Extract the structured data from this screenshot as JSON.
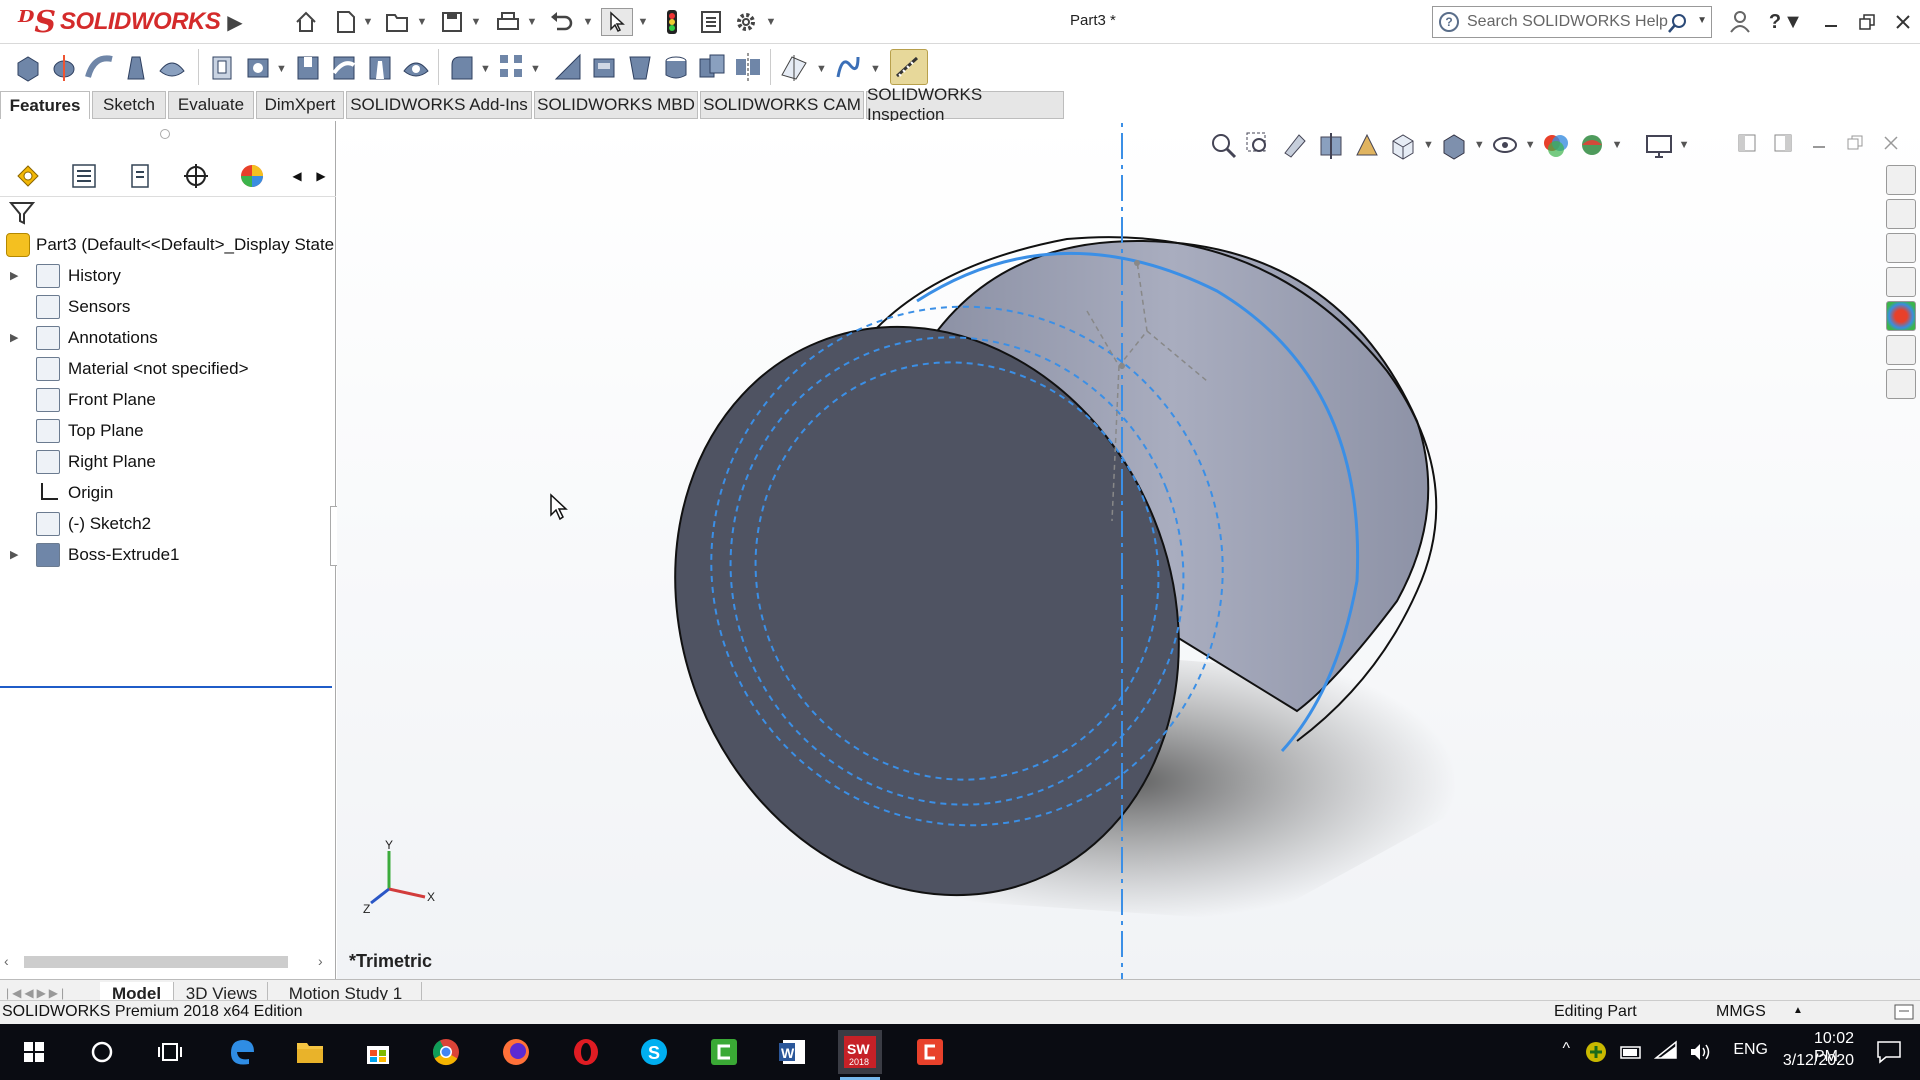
{
  "titlebar": {
    "brand": "SOLIDWORKS",
    "doc_title": "Part3 *",
    "search_placeholder": "Search SOLIDWORKS Help"
  },
  "tabs": [
    {
      "label": "Features",
      "active": true
    },
    {
      "label": "Sketch"
    },
    {
      "label": "Evaluate"
    },
    {
      "label": "DimXpert"
    },
    {
      "label": "SOLIDWORKS Add-Ins"
    },
    {
      "label": "SOLIDWORKS MBD"
    },
    {
      "label": "SOLIDWORKS CAM"
    },
    {
      "label": "SOLIDWORKS Inspection"
    }
  ],
  "tree": {
    "root": "Part3  (Default<<Default>_Display State",
    "items": [
      {
        "label": "History",
        "expandable": true,
        "icon": "history-icon"
      },
      {
        "label": "Sensors",
        "expandable": false,
        "icon": "sensors-icon"
      },
      {
        "label": "Annotations",
        "expandable": true,
        "icon": "annotations-icon"
      },
      {
        "label": "Material <not specified>",
        "expandable": false,
        "icon": "material-icon"
      },
      {
        "label": "Front Plane",
        "expandable": false,
        "icon": "plane-icon"
      },
      {
        "label": "Top Plane",
        "expandable": false,
        "icon": "plane-icon"
      },
      {
        "label": "Right Plane",
        "expandable": false,
        "icon": "plane-icon"
      },
      {
        "label": "Origin",
        "expandable": false,
        "icon": "origin-icon"
      },
      {
        "label": "(-) Sketch2",
        "expandable": false,
        "icon": "sketch-icon"
      },
      {
        "label": "Boss-Extrude1",
        "expandable": true,
        "icon": "extrude-icon"
      }
    ]
  },
  "viewport": {
    "view_name": "*Trimetric",
    "triad": {
      "x": "X",
      "y": "Y",
      "z": "Z"
    }
  },
  "bottom_tabs": [
    {
      "label": "Model",
      "active": true
    },
    {
      "label": "3D Views"
    },
    {
      "label": "Motion Study 1"
    }
  ],
  "status": {
    "edition": "SOLIDWORKS Premium 2018 x64 Edition",
    "mode": "Editing Part",
    "units": "MMGS"
  },
  "taskbar": {
    "sw_badge": "2018",
    "lang": "ENG",
    "time": "10:02 PM",
    "date": "3/12/2020"
  },
  "colors": {
    "accent": "#1f5cc8",
    "brand": "#d42b2b",
    "taskbar": "#0a0c12",
    "sketch_blue": "#3b8fe6",
    "cylinder_face": "#4f5362",
    "cylinder_side": "#9ea2b4"
  }
}
